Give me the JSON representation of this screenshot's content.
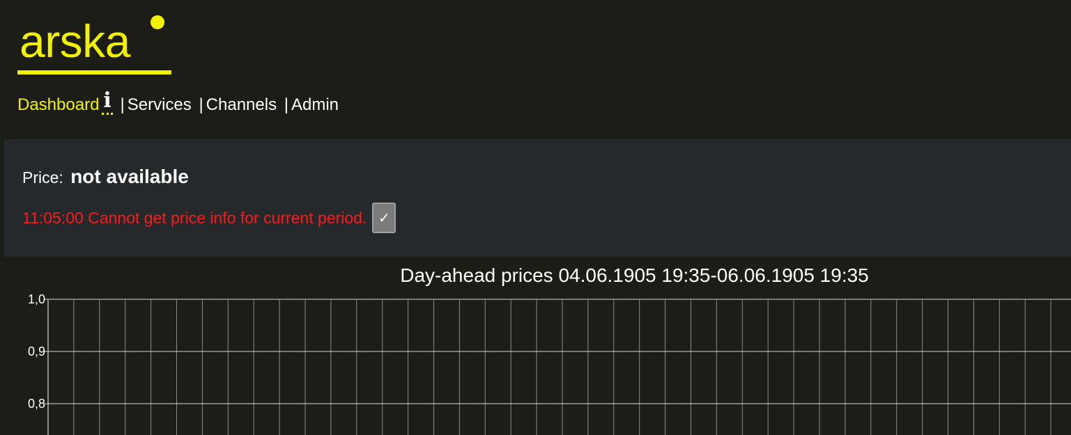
{
  "brand": {
    "name": "arska",
    "color": "#f2f200"
  },
  "nav": {
    "items": [
      {
        "label": "Dashboard",
        "active": true
      },
      {
        "label": "Services",
        "active": false
      },
      {
        "label": "Channels",
        "active": false
      },
      {
        "label": "Admin",
        "active": false
      }
    ],
    "separator": "|",
    "info_icon": "info-icon"
  },
  "status": {
    "price_label": "Price:",
    "price_value": "not available",
    "message": "11:05:00 Cannot get price info for current period.",
    "ack_glyph": "✓",
    "message_color": "#ff1a1a"
  },
  "chart_data": {
    "type": "line",
    "title": "Day-ahead prices 04.06.1905 19:35-06.06.1905 19:35",
    "y_ticks": [
      "1,0",
      "0,9",
      "0,8"
    ],
    "ylim": [
      0.8,
      1.0
    ],
    "grid": true,
    "series": []
  }
}
